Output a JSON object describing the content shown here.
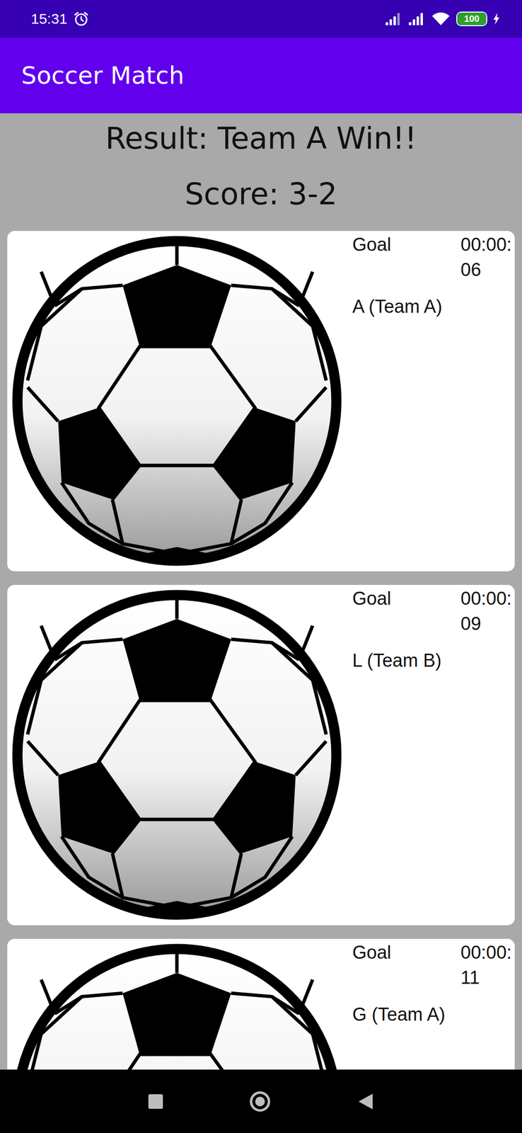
{
  "status_bar": {
    "time": "15:31",
    "alarm": true,
    "battery": "100",
    "level": 1,
    "charging": true
  },
  "app_bar": {
    "title": "Soccer Match"
  },
  "result": "Result: Team A Win!!",
  "score": "Score: 3-2",
  "events": [
    {
      "label": "Goal",
      "time": "00:00:06",
      "player": "A (Team A)"
    },
    {
      "label": "Goal",
      "time": "00:00:09",
      "player": "L (Team B)"
    },
    {
      "label": "Goal",
      "time": "00:00:11",
      "player": "G (Team A)"
    }
  ]
}
